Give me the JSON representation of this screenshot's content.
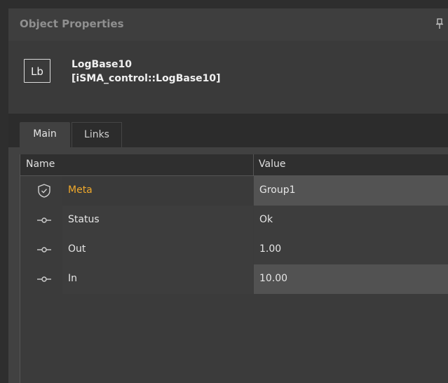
{
  "panel": {
    "title": "Object Properties",
    "pin_icon": "pin-icon"
  },
  "object": {
    "icon_text": "Lb",
    "name": "LogBase10",
    "type": "[iSMA_control::LogBase10]"
  },
  "tabs": [
    {
      "label": "Main",
      "active": true
    },
    {
      "label": "Links",
      "active": false
    }
  ],
  "table": {
    "headers": {
      "name": "Name",
      "value": "Value"
    },
    "rows": [
      {
        "icon": "shield-check-icon",
        "name": "Meta",
        "value": "Group1",
        "highlight_color": "#f0a92b"
      },
      {
        "icon": "slot-icon",
        "name": "Status",
        "value": "Ok"
      },
      {
        "icon": "slot-icon",
        "name": "Out",
        "value": "1.00"
      },
      {
        "icon": "slot-icon",
        "name": "In",
        "value": "10.00"
      }
    ]
  },
  "colors": {
    "background": "#414141",
    "accent_meta": "#f0a92b",
    "header_dark": "#2c2c2c"
  }
}
